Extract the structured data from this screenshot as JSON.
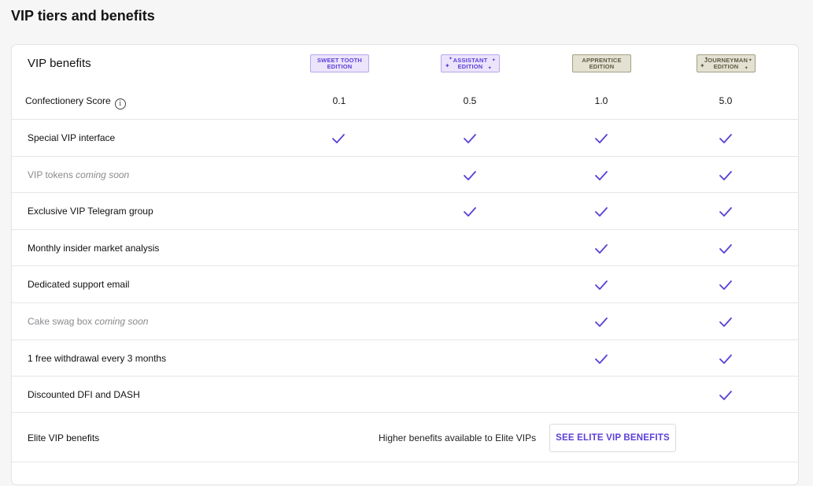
{
  "page": {
    "title": "VIP tiers and benefits"
  },
  "table": {
    "header_title": "VIP benefits",
    "tiers": [
      {
        "line1": "SWEET TOOTH",
        "line2": "EDITION",
        "style": "purple"
      },
      {
        "line1": "ASSISTANT",
        "line2": "EDITION",
        "style": "purple"
      },
      {
        "line1": "APPRENTICE",
        "line2": "EDITION",
        "style": "tan"
      },
      {
        "line1": "JOURNEYMAN",
        "line2": "EDITION",
        "style": "tan"
      }
    ],
    "score": {
      "label": "Confectionery Score",
      "info_icon": "info-icon",
      "values": [
        "0.1",
        "0.5",
        "1.0",
        "5.0"
      ]
    },
    "benefits": [
      {
        "label": "Special VIP interface",
        "soon": "",
        "muted": false,
        "checks": [
          true,
          true,
          true,
          true
        ]
      },
      {
        "label": "VIP tokens",
        "soon": "coming soon",
        "muted": true,
        "checks": [
          false,
          true,
          true,
          true
        ]
      },
      {
        "label": "Exclusive VIP Telegram group",
        "soon": "",
        "muted": false,
        "checks": [
          false,
          true,
          true,
          true
        ]
      },
      {
        "label": "Monthly insider market analysis",
        "soon": "",
        "muted": false,
        "checks": [
          false,
          false,
          true,
          true
        ]
      },
      {
        "label": "Dedicated support email",
        "soon": "",
        "muted": false,
        "checks": [
          false,
          false,
          true,
          true
        ]
      },
      {
        "label": "Cake swag box",
        "soon": "coming soon",
        "muted": true,
        "checks": [
          false,
          false,
          true,
          true
        ]
      },
      {
        "label": "1 free withdrawal every 3 months",
        "soon": "",
        "muted": false,
        "checks": [
          false,
          false,
          true,
          true
        ]
      },
      {
        "label": "Discounted DFI and DASH",
        "soon": "",
        "muted": false,
        "checks": [
          false,
          false,
          false,
          true
        ]
      }
    ],
    "elite": {
      "label": "Elite VIP benefits",
      "text": "Higher benefits available to Elite VIPs",
      "button_label": "SEE ELITE VIP BENEFITS"
    }
  },
  "colors": {
    "accent": "#5b3fd6",
    "check": "#5b3fd6",
    "badge_purple_bg": "#ebe4fb",
    "badge_tan_bg": "#e3e1d1"
  },
  "icons": {
    "check": "checkmark-icon",
    "info": "info-icon",
    "sparkle": "sparkle-icon"
  }
}
